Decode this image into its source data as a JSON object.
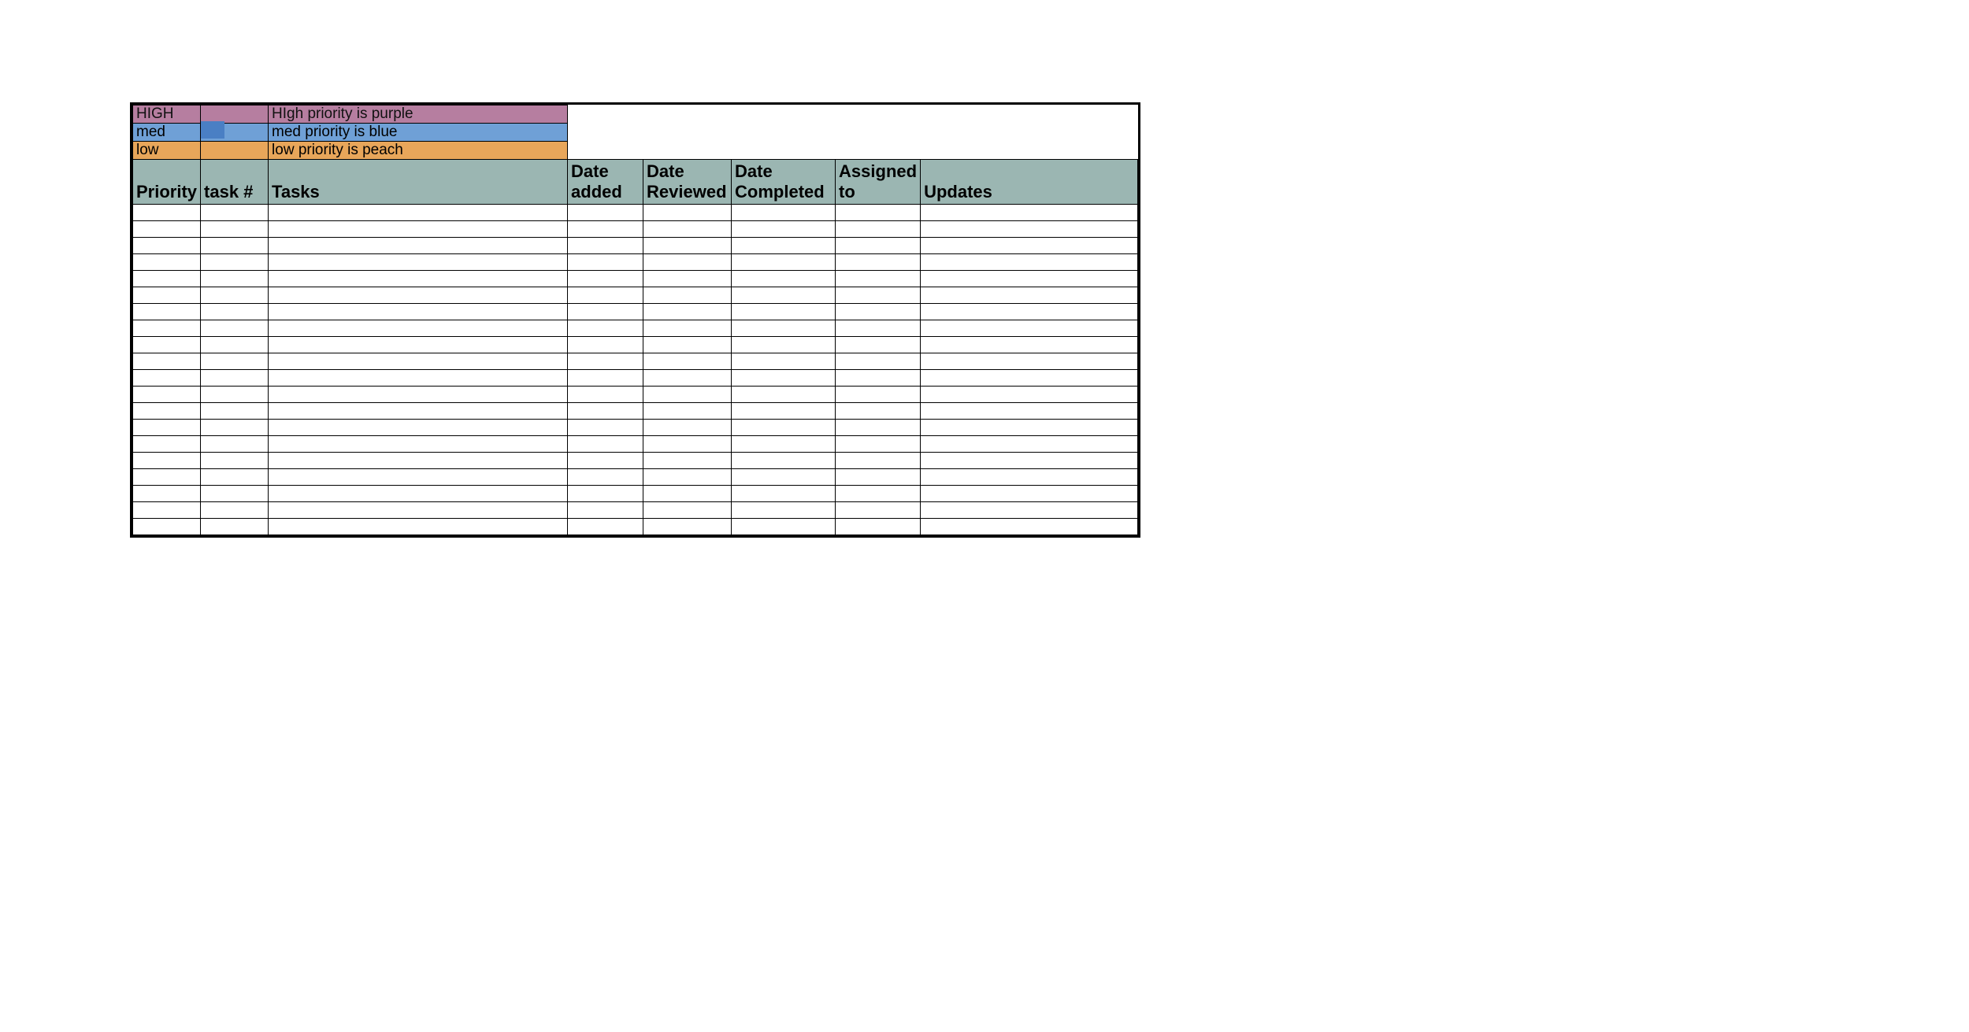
{
  "legend": [
    {
      "label": "HIGH",
      "description": "HIgh priority is purple",
      "color": "#b67ea0",
      "swatch": "#b67ea0"
    },
    {
      "label": "med",
      "description": "med priority is blue",
      "color": "#6fa0d6",
      "swatch": "#4a7fc4"
    },
    {
      "label": "low",
      "description": "low priority is peach",
      "color": "#e8a65a",
      "swatch": "#e8a65a"
    }
  ],
  "columns": {
    "priority": "Priority",
    "task_num": "task #",
    "tasks": "Tasks",
    "date_added": "Date added",
    "date_reviewed": "Date Reviewed",
    "date_completed": "Date Completed",
    "assigned_to": "Assigned to",
    "updates": "Updates"
  },
  "rows": [
    {},
    {},
    {},
    {},
    {},
    {},
    {},
    {},
    {},
    {},
    {},
    {},
    {},
    {},
    {},
    {},
    {},
    {},
    {},
    {}
  ]
}
